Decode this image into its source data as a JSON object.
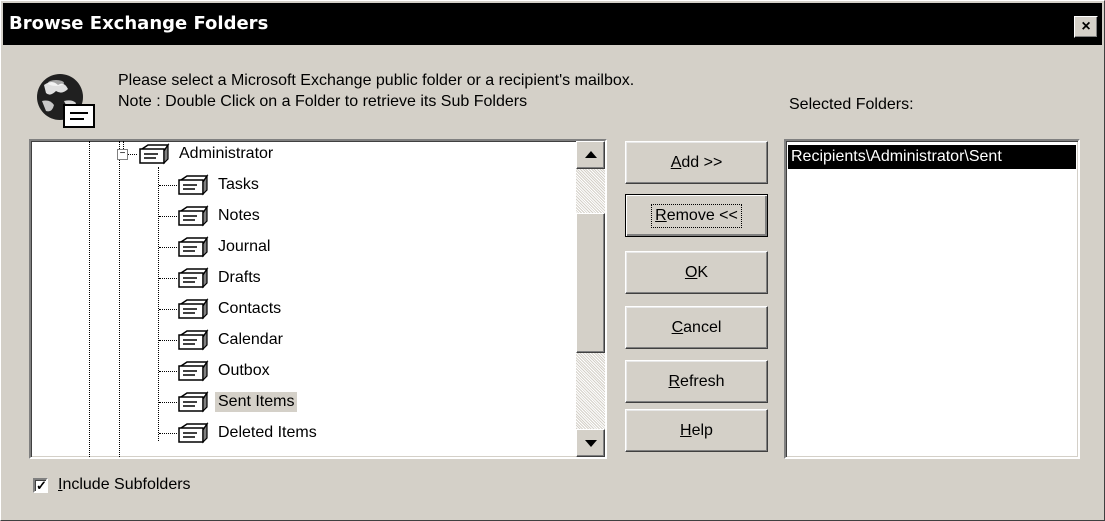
{
  "window": {
    "title": "Browse Exchange Folders",
    "close_glyph": "×"
  },
  "message": {
    "line1": "Please select a Microsoft Exchange public folder or a recipient's mailbox.",
    "line2": "Note : Double Click on a Folder to retrieve its Sub Folders"
  },
  "selected_folders_label": "Selected Folders:",
  "tree": {
    "root": {
      "label": "Administrator",
      "expander": "−",
      "icon": "mail-folder-icon"
    },
    "children": [
      {
        "label": "Tasks"
      },
      {
        "label": "Notes"
      },
      {
        "label": "Journal"
      },
      {
        "label": "Drafts"
      },
      {
        "label": "Contacts"
      },
      {
        "label": "Calendar"
      },
      {
        "label": "Outbox"
      },
      {
        "label": "Sent Items",
        "selected": true
      },
      {
        "label": "Deleted Items"
      }
    ]
  },
  "buttons": {
    "add": {
      "mnemonic": "A",
      "rest": "dd >>"
    },
    "remove": {
      "mnemonic": "R",
      "rest": "emove <<"
    },
    "ok": {
      "mnemonic": "O",
      "rest": "K"
    },
    "cancel": {
      "mnemonic": "C",
      "rest": "ancel"
    },
    "refresh": {
      "mnemonic": "R",
      "rest": "efresh"
    },
    "help": {
      "mnemonic": "H",
      "rest": "elp"
    }
  },
  "selected_folders": [
    "Recipients\\Administrator\\Sent"
  ],
  "include_subfolders": {
    "checked": true,
    "mnemonic": "I",
    "rest": "nclude Subfolders"
  },
  "colors": {
    "dialog_bg": "#d4d0c8",
    "titlebar_bg": "#000000",
    "selection_bg": "#000000"
  }
}
